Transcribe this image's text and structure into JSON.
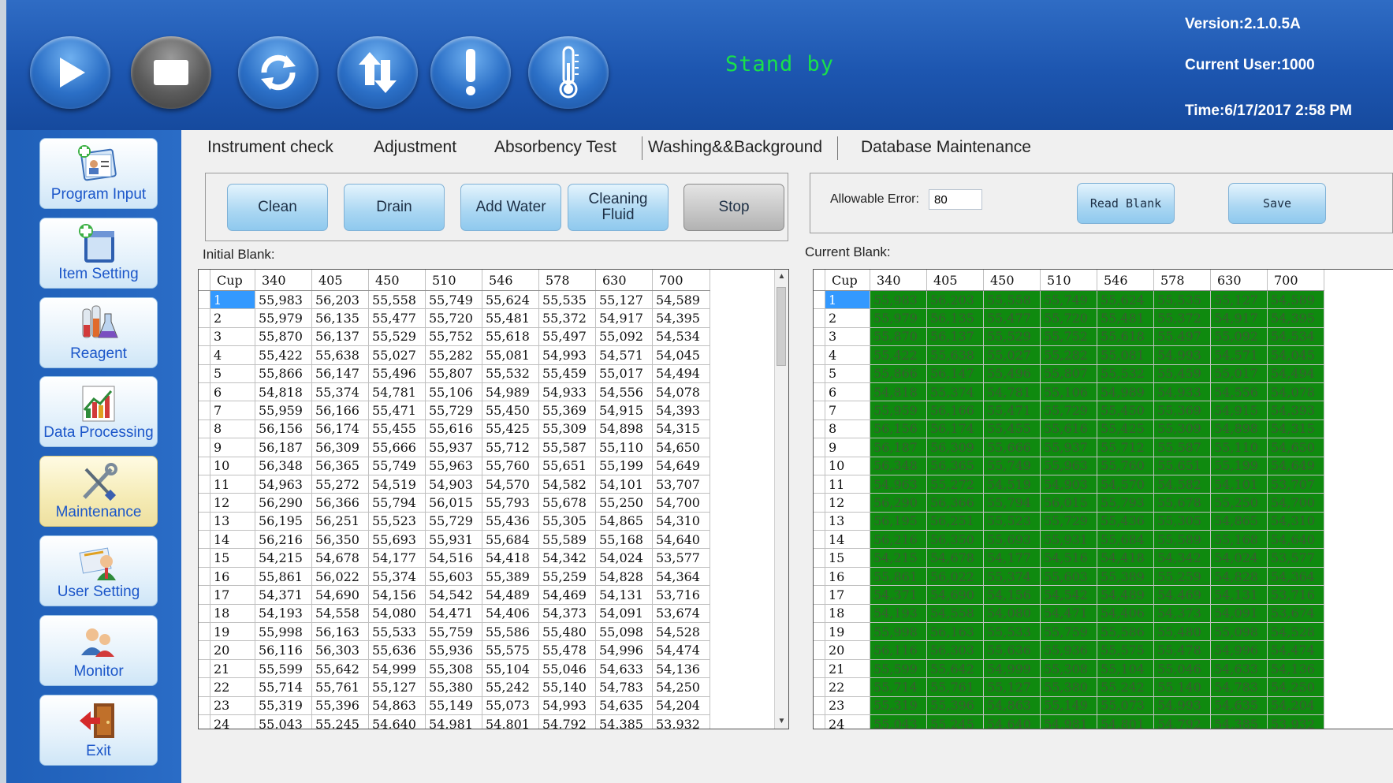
{
  "header": {
    "status": "Stand by",
    "version": "Version:2.1.0.5A",
    "current_user": "Current User:1000",
    "time": "Time:6/17/2017 2:58 PM",
    "toolbar": [
      {
        "icon": "play-icon"
      },
      {
        "icon": "stop-icon"
      },
      {
        "icon": "refresh-icon"
      },
      {
        "icon": "transfer-icon"
      },
      {
        "icon": "alert-icon"
      },
      {
        "icon": "thermometer-icon"
      }
    ]
  },
  "sidebar": {
    "items": [
      {
        "label": "Program Input",
        "icon": "program-input-icon"
      },
      {
        "label": "Item Setting",
        "icon": "item-setting-icon"
      },
      {
        "label": "Reagent",
        "icon": "reagent-icon"
      },
      {
        "label": "Data Processing",
        "icon": "data-processing-icon"
      },
      {
        "label": "Maintenance",
        "icon": "maintenance-icon",
        "active": true
      },
      {
        "label": "User Setting",
        "icon": "user-setting-icon"
      },
      {
        "label": "Monitor",
        "icon": "monitor-icon"
      },
      {
        "label": "Exit",
        "icon": "exit-icon"
      }
    ]
  },
  "tabs": [
    "Instrument check",
    "Adjustment",
    "Absorbency Test",
    "Washing&&Background",
    "Database Maintenance"
  ],
  "actions": {
    "clean": "Clean",
    "drain": "Drain",
    "add_water": "Add Water",
    "cleaning_fluid": "Cleaning Fluid",
    "stop": "Stop"
  },
  "blank_settings": {
    "allowable_error_label": "Allowable Error:",
    "allowable_error_value": "80",
    "read_blank": "Read Blank",
    "save": "Save"
  },
  "initial_blank_label": "Initial Blank:",
  "current_blank_label": "Current Blank:",
  "columns": [
    "Cup",
    "340",
    "405",
    "450",
    "510",
    "546",
    "578",
    "630",
    "700"
  ],
  "rows": [
    [
      "1",
      "55,983",
      "56,203",
      "55,558",
      "55,749",
      "55,624",
      "55,535",
      "55,127",
      "54,589"
    ],
    [
      "2",
      "55,979",
      "56,135",
      "55,477",
      "55,720",
      "55,481",
      "55,372",
      "54,917",
      "54,395"
    ],
    [
      "3",
      "55,870",
      "56,137",
      "55,529",
      "55,752",
      "55,618",
      "55,497",
      "55,092",
      "54,534"
    ],
    [
      "4",
      "55,422",
      "55,638",
      "55,027",
      "55,282",
      "55,081",
      "54,993",
      "54,571",
      "54,045"
    ],
    [
      "5",
      "55,866",
      "56,147",
      "55,496",
      "55,807",
      "55,532",
      "55,459",
      "55,017",
      "54,494"
    ],
    [
      "6",
      "54,818",
      "55,374",
      "54,781",
      "55,106",
      "54,989",
      "54,933",
      "54,556",
      "54,078"
    ],
    [
      "7",
      "55,959",
      "56,166",
      "55,471",
      "55,729",
      "55,450",
      "55,369",
      "54,915",
      "54,393"
    ],
    [
      "8",
      "56,156",
      "56,174",
      "55,455",
      "55,616",
      "55,425",
      "55,309",
      "54,898",
      "54,315"
    ],
    [
      "9",
      "56,187",
      "56,309",
      "55,666",
      "55,937",
      "55,712",
      "55,587",
      "55,110",
      "54,650"
    ],
    [
      "10",
      "56,348",
      "56,365",
      "55,749",
      "55,963",
      "55,760",
      "55,651",
      "55,199",
      "54,649"
    ],
    [
      "11",
      "54,963",
      "55,272",
      "54,519",
      "54,903",
      "54,570",
      "54,582",
      "54,101",
      "53,707"
    ],
    [
      "12",
      "56,290",
      "56,366",
      "55,794",
      "56,015",
      "55,793",
      "55,678",
      "55,250",
      "54,700"
    ],
    [
      "13",
      "56,195",
      "56,251",
      "55,523",
      "55,729",
      "55,436",
      "55,305",
      "54,865",
      "54,310"
    ],
    [
      "14",
      "56,216",
      "56,350",
      "55,693",
      "55,931",
      "55,684",
      "55,589",
      "55,168",
      "54,640"
    ],
    [
      "15",
      "54,215",
      "54,678",
      "54,177",
      "54,516",
      "54,418",
      "54,342",
      "54,024",
      "53,577"
    ],
    [
      "16",
      "55,861",
      "56,022",
      "55,374",
      "55,603",
      "55,389",
      "55,259",
      "54,828",
      "54,364"
    ],
    [
      "17",
      "54,371",
      "54,690",
      "54,156",
      "54,542",
      "54,489",
      "54,469",
      "54,131",
      "53,716"
    ],
    [
      "18",
      "54,193",
      "54,558",
      "54,080",
      "54,471",
      "54,406",
      "54,373",
      "54,091",
      "53,674"
    ],
    [
      "19",
      "55,998",
      "56,163",
      "55,533",
      "55,759",
      "55,586",
      "55,480",
      "55,098",
      "54,528"
    ],
    [
      "20",
      "56,116",
      "56,303",
      "55,636",
      "55,936",
      "55,575",
      "55,478",
      "54,996",
      "54,474"
    ],
    [
      "21",
      "55,599",
      "55,642",
      "54,999",
      "55,308",
      "55,104",
      "55,046",
      "54,633",
      "54,136"
    ],
    [
      "22",
      "55,714",
      "55,761",
      "55,127",
      "55,380",
      "55,242",
      "55,140",
      "54,783",
      "54,250"
    ],
    [
      "23",
      "55,319",
      "55,396",
      "54,863",
      "55,149",
      "55,073",
      "54,993",
      "54,635",
      "54,204"
    ],
    [
      "24",
      "55,043",
      "55,245",
      "54,640",
      "54,981",
      "54,801",
      "54,792",
      "54,385",
      "53,932"
    ]
  ]
}
